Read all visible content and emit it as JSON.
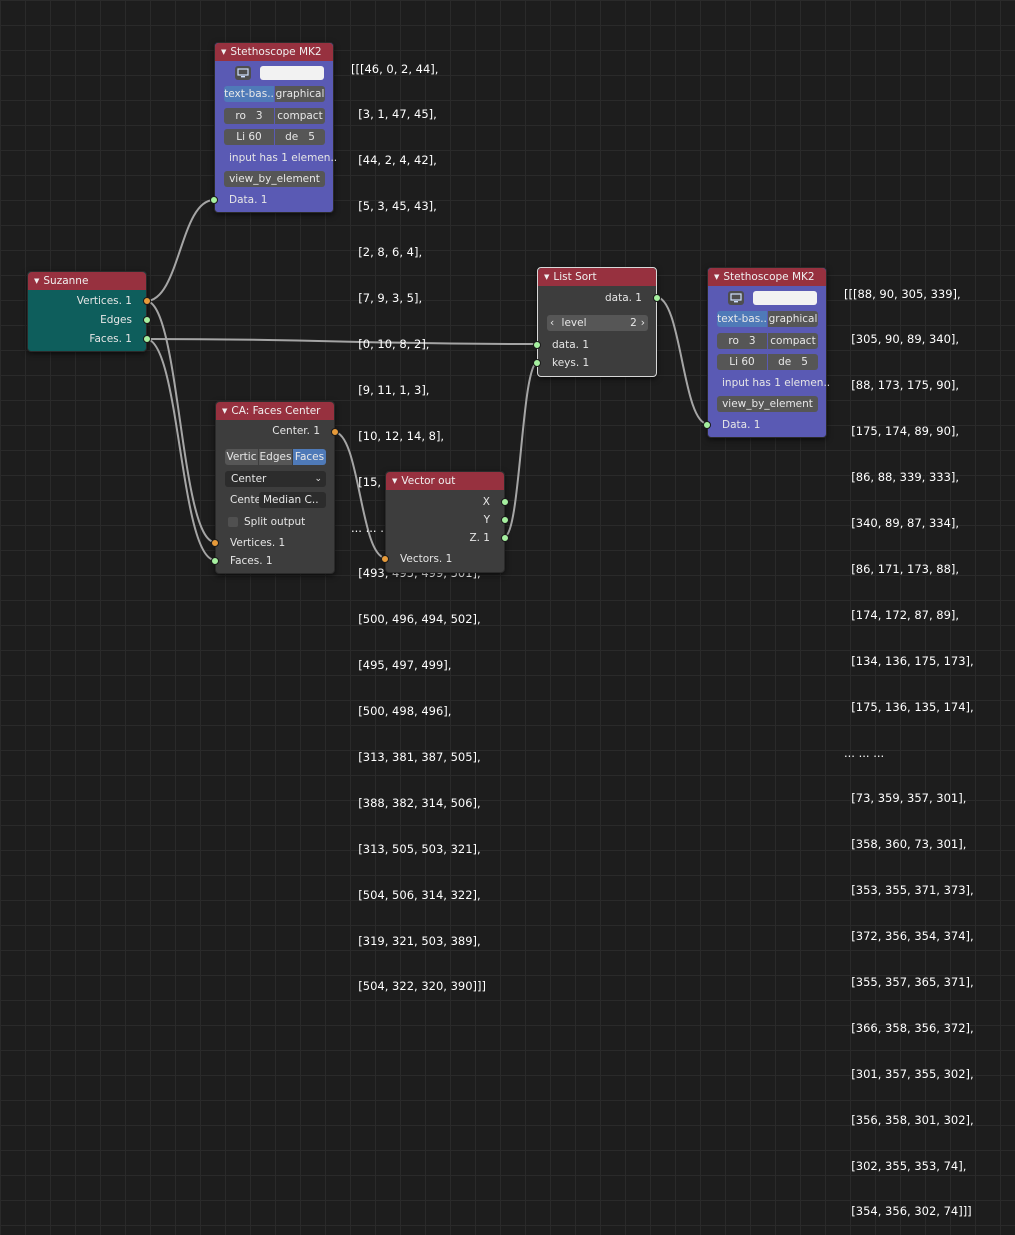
{
  "colors": {
    "header_red": "#97313f",
    "socket_green": "#a6f0a0",
    "socket_orange": "#e69a3a",
    "purple_node": "#5a5ab4",
    "teal_node": "#0e5e5c",
    "accent_blue": "#4f7ab8"
  },
  "stethoscope1": {
    "title": "Stethoscope MK2",
    "mode_text": "text-bas..",
    "mode_graphical": "graphical",
    "ro_label": "ro",
    "ro_value": "3",
    "compact": "compact",
    "li_label": "Li",
    "li_value": "60",
    "de_label": "de",
    "de_value": "5",
    "info": "input has 1 elemen..",
    "view_button": "view_by_element",
    "input_socket": "Data. 1",
    "output_lines": [
      "[[[46, 0, 2, 44],",
      "  [3, 1, 47, 45],",
      "  [44, 2, 4, 42],",
      "  [5, 3, 45, 43],",
      "  [2, 8, 6, 4],",
      "  [7, 9, 3, 5],",
      "  [0, 10, 8, 2],",
      "  [9, 11, 1, 3],",
      "  [10, 12, 14, 8],",
      "  [15, 13, 11, 9],",
      "... ... ...",
      "  [493, 495, 499, 501],",
      "  [500, 496, 494, 502],",
      "  [495, 497, 499],",
      "  [500, 498, 496],",
      "  [313, 381, 387, 505],",
      "  [388, 382, 314, 506],",
      "  [313, 505, 503, 321],",
      "  [504, 506, 314, 322],",
      "  [319, 321, 503, 389],",
      "  [504, 322, 320, 390]]]"
    ]
  },
  "suzanne": {
    "title": "Suzanne",
    "outputs": [
      "Vertices. 1",
      "Edges",
      "Faces. 1"
    ]
  },
  "faces_center": {
    "title": "CA: Faces Center",
    "output": "Center. 1",
    "seg": [
      "Vertic",
      "Edges",
      "Faces"
    ],
    "dropdown1": "Center",
    "cente_label": "Cente",
    "dropdown2": "Median C..",
    "split_output": "Split output",
    "inputs": [
      "Vertices. 1",
      "Faces. 1"
    ]
  },
  "vector_out": {
    "title": "Vector out",
    "outputs": [
      "X",
      "Y",
      "Z. 1"
    ],
    "input": "Vectors. 1"
  },
  "list_sort": {
    "title": "List Sort",
    "output": "data. 1",
    "level_label": "level",
    "level_value": "2",
    "inputs": [
      "data. 1",
      "keys. 1"
    ]
  },
  "stethoscope2": {
    "title": "Stethoscope MK2",
    "mode_text": "text-bas..",
    "mode_graphical": "graphical",
    "ro_label": "ro",
    "ro_value": "3",
    "compact": "compact",
    "li_label": "Li",
    "li_value": "60",
    "de_label": "de",
    "de_value": "5",
    "info": "input has 1 elemen..",
    "view_button": "view_by_element",
    "input_socket": "Data. 1",
    "output_lines": [
      "[[[88, 90, 305, 339],",
      "  [305, 90, 89, 340],",
      "  [88, 173, 175, 90],",
      "  [175, 174, 89, 90],",
      "  [86, 88, 339, 333],",
      "  [340, 89, 87, 334],",
      "  [86, 171, 173, 88],",
      "  [174, 172, 87, 89],",
      "  [134, 136, 175, 173],",
      "  [175, 136, 135, 174],",
      "... ... ...",
      "  [73, 359, 357, 301],",
      "  [358, 360, 73, 301],",
      "  [353, 355, 371, 373],",
      "  [372, 356, 354, 374],",
      "  [355, 357, 365, 371],",
      "  [366, 358, 356, 372],",
      "  [301, 357, 355, 302],",
      "  [356, 358, 301, 302],",
      "  [302, 355, 353, 74],",
      "  [354, 356, 302, 74]]]"
    ]
  }
}
